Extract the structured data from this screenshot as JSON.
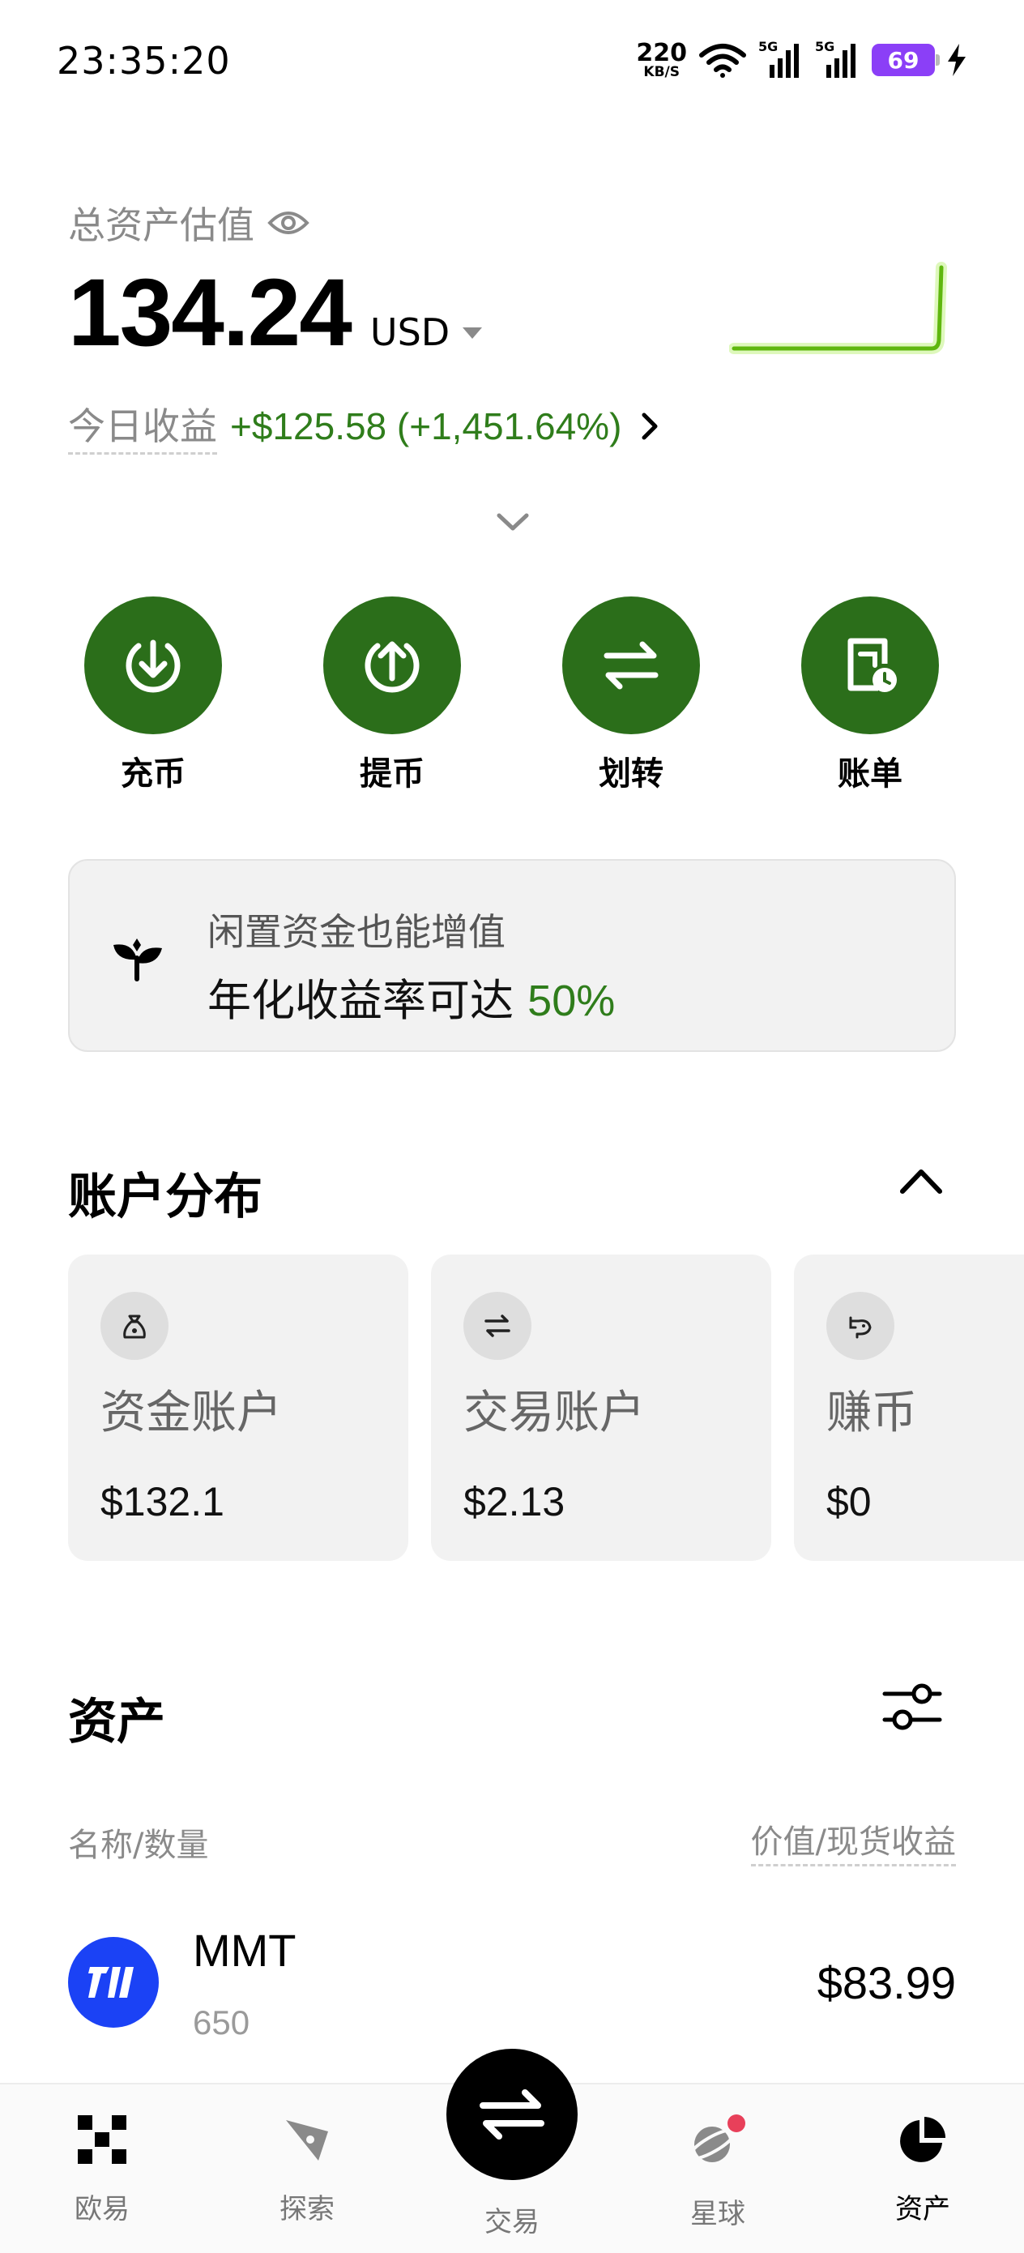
{
  "status_bar": {
    "time": "23:35:20",
    "net_speed": "220",
    "net_unit": "KB/S",
    "signal1": "5G",
    "signal2": "5G",
    "battery": "69"
  },
  "overview": {
    "total_label": "总资产估值",
    "total_value": "134.24",
    "currency": "USD",
    "pnl_label": "今日收益",
    "pnl_value": "+$125.58 (+1,451.64%)"
  },
  "actions": [
    {
      "label": "充币",
      "icon": "deposit-icon"
    },
    {
      "label": "提币",
      "icon": "withdraw-icon"
    },
    {
      "label": "划转",
      "icon": "transfer-icon"
    },
    {
      "label": "账单",
      "icon": "bill-icon"
    }
  ],
  "promo": {
    "line1": "闲置资金也能增值",
    "line2_prefix": "年化收益率可达 ",
    "line2_highlight": "50%"
  },
  "account_section": {
    "title": "账户分布",
    "cards": [
      {
        "name": "资金账户",
        "value": "$132.1",
        "icon": "money-bag-icon"
      },
      {
        "name": "交易账户",
        "value": "$2.13",
        "icon": "swap-icon"
      },
      {
        "name": "赚币",
        "value": "$0",
        "icon": "piggy-bank-icon"
      }
    ]
  },
  "assets_section": {
    "title": "资产",
    "col_left": "名称/数量",
    "col_right": "价值/现货收益",
    "rows": [
      {
        "name": "MMT",
        "qty": "650",
        "value": "$83.99"
      }
    ]
  },
  "bottom_nav": {
    "items": [
      {
        "label": "欧易",
        "icon": "okx-logo-icon"
      },
      {
        "label": "探索",
        "icon": "compass-icon"
      },
      {
        "label": "交易",
        "icon": "trade-swap-icon"
      },
      {
        "label": "星球",
        "icon": "planet-icon"
      },
      {
        "label": "资产",
        "icon": "pie-chart-icon"
      }
    ],
    "active": "资产"
  },
  "colors": {
    "accent_green": "#2b6e1a",
    "gain_green": "#2f7d1b",
    "coin_blue": "#1b42f5",
    "battery_purple": "#8b3ff7"
  }
}
